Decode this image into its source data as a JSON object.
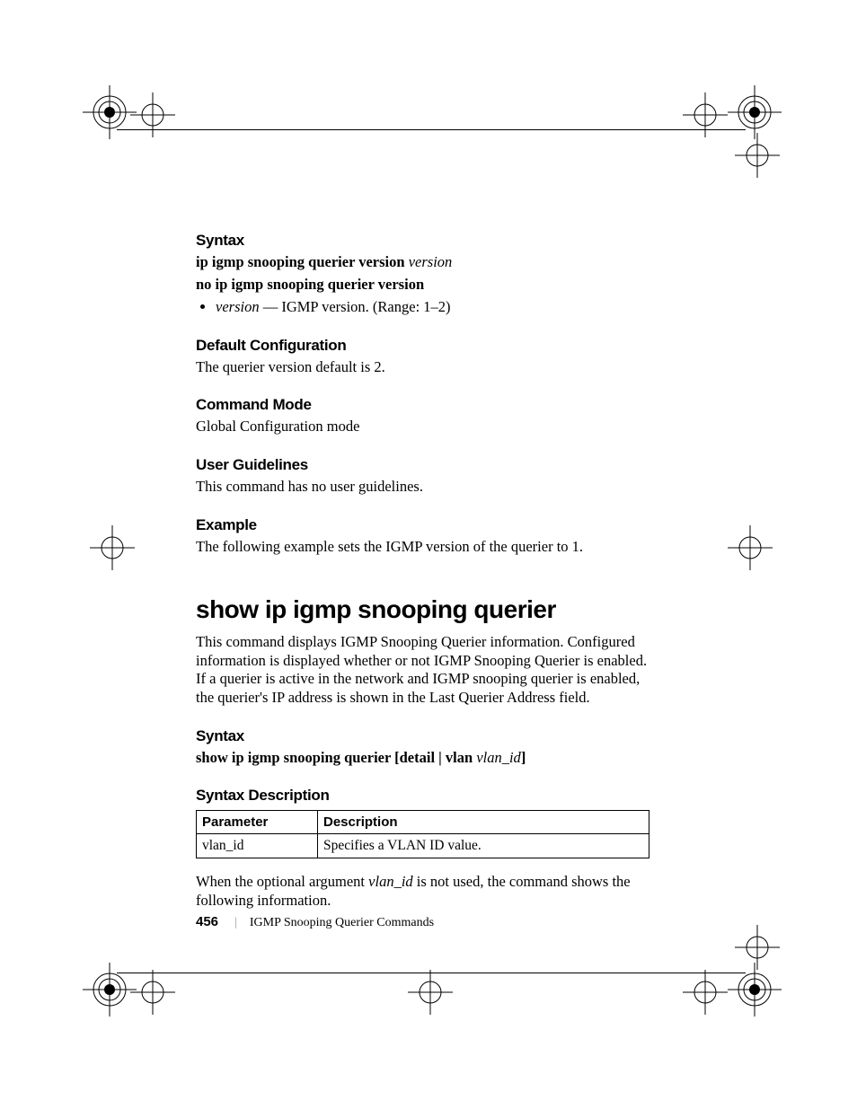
{
  "section1": {
    "heading": "Syntax",
    "line1_bold": "ip igmp snooping querier version ",
    "line1_ital": "version",
    "line2_bold": "no ip igmp snooping querier version",
    "bullet_ital": "version",
    "bullet_rest": " — IGMP version. (Range: 1–2)"
  },
  "section2": {
    "heading": "Default Configuration",
    "body": "The querier version default is 2."
  },
  "section3": {
    "heading": "Command Mode",
    "body": "Global Configuration mode"
  },
  "section4": {
    "heading": "User Guidelines",
    "body": "This command has no user guidelines."
  },
  "section5": {
    "heading": "Example",
    "body": "The following example sets the IGMP version of the querier to 1."
  },
  "command": {
    "title": "show ip igmp snooping querier",
    "desc": "This command displays IGMP Snooping Querier information. Configured information is displayed whether or not IGMP Snooping Querier is enabled. If a querier is active in the network and IGMP snooping querier is enabled, the querier's IP address is shown in the Last Querier Address field."
  },
  "section6": {
    "heading": "Syntax",
    "line_bold": "show ip igmp snooping querier [detail | vlan ",
    "line_ital": "vlan_id",
    "line_end": "]"
  },
  "section7": {
    "heading": "Syntax Description",
    "table": {
      "header_param": "Parameter",
      "header_desc": "Description",
      "row1_param": "vlan_id",
      "row1_desc": "Specifies a VLAN ID value."
    },
    "after_pre": "When the optional argument ",
    "after_ital": "vlan_id",
    "after_post": " is not used, the command shows the following information."
  },
  "footer": {
    "page_number": "456",
    "section_title": "IGMP Snooping Querier Commands"
  }
}
